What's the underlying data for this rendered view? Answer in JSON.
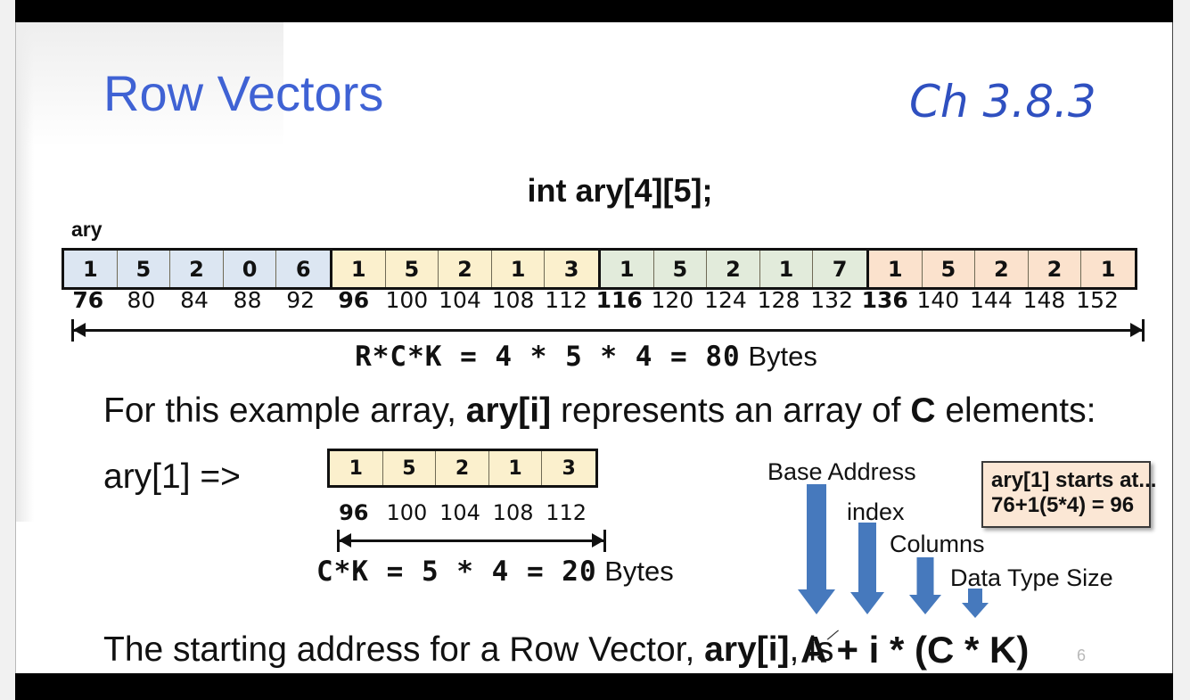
{
  "slide": {
    "title": "Row Vectors",
    "chapter": "Ch 3.8.3",
    "declaration": "int ary[4][5];",
    "slide_number": "6"
  },
  "main_array": {
    "label": "ary",
    "values": [
      "1",
      "5",
      "2",
      "0",
      "6",
      "1",
      "5",
      "2",
      "1",
      "3",
      "1",
      "5",
      "2",
      "1",
      "7",
      "1",
      "5",
      "2",
      "2",
      "1"
    ],
    "addresses": [
      "76",
      "80",
      "84",
      "88",
      "92",
      "96",
      "100",
      "104",
      "108",
      "112",
      "116",
      "120",
      "124",
      "128",
      "132",
      "136",
      "140",
      "144",
      "148",
      "152"
    ],
    "bold_addresses": [
      "76",
      "96",
      "116",
      "136"
    ],
    "row_colors": [
      "#dce6f2",
      "#fbf0cd",
      "#e2ebdb",
      "#fbe2cd"
    ],
    "formula_mono": "R*C*K  =  4  *  5  *  4  =  80",
    "formula_unit": "Bytes"
  },
  "prose": {
    "line1_a": "For this example array, ",
    "line1_b": "ary[i]",
    "line1_c": " represents an array of ",
    "line1_d": "C",
    "line1_e": " elements:",
    "line2_a": "The starting address for a Row Vector, ",
    "line2_b": "ary[i]",
    "line2_c": ", is"
  },
  "row_vector": {
    "label": "ary[1] =>",
    "values": [
      "1",
      "5",
      "2",
      "1",
      "3"
    ],
    "addresses": [
      "96",
      "100",
      "104",
      "108",
      "112"
    ],
    "bold_addresses": [
      "96"
    ],
    "color": "#fbf0cd",
    "formula_mono": "C*K  =  5  *  4  =  20",
    "formula_unit": "Bytes"
  },
  "arrow_diagram": {
    "arrow_color": "#4679bd",
    "labels": [
      {
        "text": "Base Address"
      },
      {
        "text": "index"
      },
      {
        "text": "Columns"
      },
      {
        "text": "Data Type Size"
      }
    ],
    "callout": {
      "line1": "ary[1] starts at...",
      "line2": "76+1(5*4) = 96",
      "bg_color": "#fbe7d5"
    }
  },
  "final_formula": {
    "text": "A + i * (C * K)"
  }
}
